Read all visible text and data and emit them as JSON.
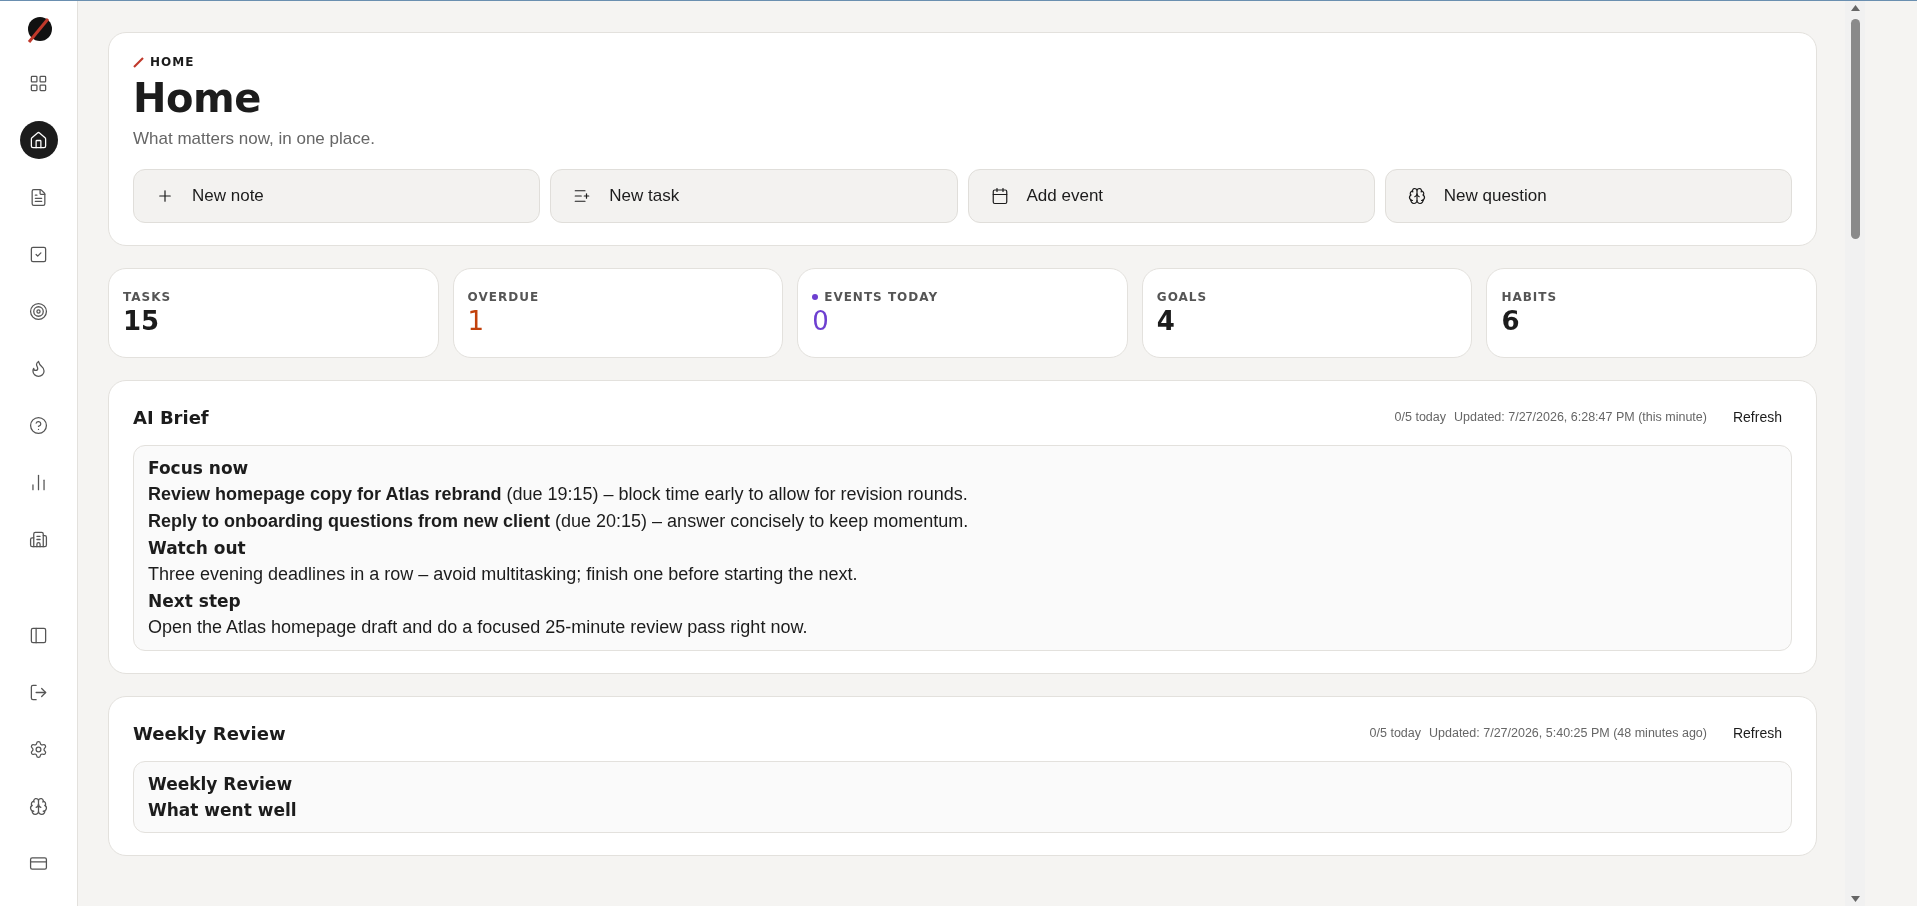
{
  "sidebar": {
    "logo": true,
    "top_items": [
      {
        "selected": false
      },
      {
        "selected": true
      },
      {
        "selected": false
      },
      {
        "selected": false
      },
      {
        "selected": false
      },
      {
        "selected": false
      },
      {
        "selected": false
      },
      {
        "selected": false
      },
      {
        "selected": false
      }
    ],
    "bottom_items": [
      {
        "selected": false
      },
      {
        "selected": false
      },
      {
        "selected": false
      },
      {
        "selected": false
      },
      {
        "selected": false
      }
    ]
  },
  "header": {
    "eyebrow": "HOME",
    "title": "Home",
    "subtitle": "What matters now, in one place.",
    "actions": [
      {
        "label": "New note"
      },
      {
        "label": "New task"
      },
      {
        "label": "Add event"
      },
      {
        "label": "New question"
      }
    ]
  },
  "stats": [
    {
      "label": "TASKS",
      "value": "15",
      "color": "#1c1c1c",
      "dot": false
    },
    {
      "label": "OVERDUE",
      "value": "1",
      "color": "#c2410c",
      "dot": false
    },
    {
      "label": "EVENTS TODAY",
      "value": "0",
      "color": "#6d3fd0",
      "dot": true
    },
    {
      "label": "GOALS",
      "value": "4",
      "color": "#1c1c1c",
      "dot": false
    },
    {
      "label": "HABITS",
      "value": "6",
      "color": "#1c1c1c",
      "dot": false
    }
  ],
  "panels": [
    {
      "title": "AI Brief",
      "usage": "0/5 today",
      "updated": "Updated: 7/27/2026, 6:28:47 PM (this minute)",
      "button": "Refresh",
      "lines": [
        {
          "kind": "heading",
          "text": "Focus now"
        },
        {
          "kind": "text",
          "text": "**Review homepage copy for Atlas rebrand** (due 19:15) – block time early to allow for revision rounds."
        },
        {
          "kind": "text",
          "text": "**Reply to onboarding questions from new client** (due 20:15) – answer concisely to keep momentum."
        },
        {
          "kind": "heading",
          "text": "Watch out"
        },
        {
          "kind": "text",
          "text": "Three evening deadlines in a row – avoid multitasking; finish one before starting the next."
        },
        {
          "kind": "heading",
          "text": "Next step"
        },
        {
          "kind": "text",
          "text": "Open the Atlas homepage draft and do a focused 25-minute review pass right now."
        }
      ]
    },
    {
      "title": "Weekly Review",
      "usage": "0/5 today",
      "updated": "Updated: 7/27/2026, 5:40:25 PM (48 minutes ago)",
      "button": "Refresh",
      "lines": [
        {
          "kind": "heading",
          "text": "Weekly Review"
        },
        {
          "kind": "heading",
          "text": "What went well"
        }
      ]
    }
  ]
}
